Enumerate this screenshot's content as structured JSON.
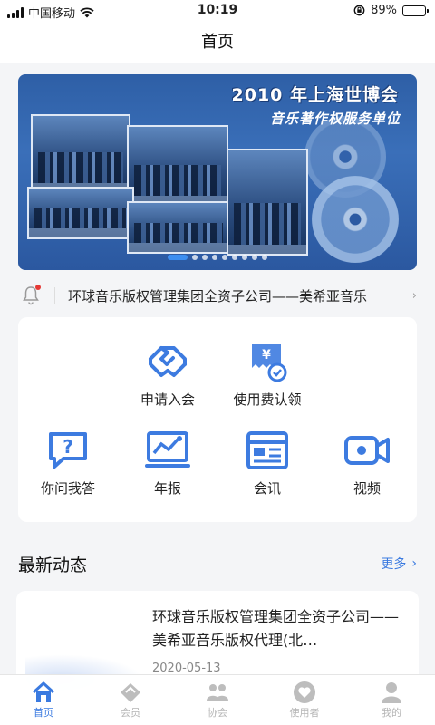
{
  "status_bar": {
    "carrier": "中国移动",
    "time": "10:19",
    "battery_text": "89%",
    "battery_level": 0.89,
    "icons": [
      "signal-icon",
      "wifi-icon",
      "lock-rotation-icon",
      "battery-icon"
    ]
  },
  "nav": {
    "title": "首页"
  },
  "banner": {
    "title": "2010 年上海世博会",
    "subtitle": "音乐著作权服务单位",
    "slide_count": 9,
    "active_index": 0
  },
  "notice": {
    "text": "环球音乐版权管理集团全资子公司——美希亚音乐",
    "icon": "bell-icon",
    "unread": true
  },
  "menu": {
    "items": [
      {
        "label": "申请入会",
        "icon": "handshake-icon"
      },
      {
        "label": "使用费认领",
        "icon": "fee-claim-icon"
      },
      {
        "label": "你问我答",
        "icon": "qa-icon"
      },
      {
        "label": "年报",
        "icon": "annual-report-icon"
      },
      {
        "label": "会讯",
        "icon": "news-icon"
      },
      {
        "label": "视频",
        "icon": "video-icon"
      }
    ]
  },
  "latest": {
    "title": "最新动态",
    "more_label": "更多",
    "items": [
      {
        "title": "环球音乐版权管理集团全资子公司——美希亚音乐版权代理(北…",
        "date": "2020-05-13"
      }
    ]
  },
  "tab_bar": {
    "items": [
      {
        "label": "首页",
        "icon": "home-icon",
        "active": true
      },
      {
        "label": "会员",
        "icon": "member-icon",
        "active": false
      },
      {
        "label": "协会",
        "icon": "association-icon",
        "active": false
      },
      {
        "label": "使用者",
        "icon": "user-heart-icon",
        "active": false
      },
      {
        "label": "我的",
        "icon": "profile-icon",
        "active": false
      }
    ]
  },
  "colors": {
    "accent": "#3a7ae0",
    "icon_blue": "#3d7be0",
    "badge_red": "#e53935",
    "inactive": "#b5b5b5"
  }
}
